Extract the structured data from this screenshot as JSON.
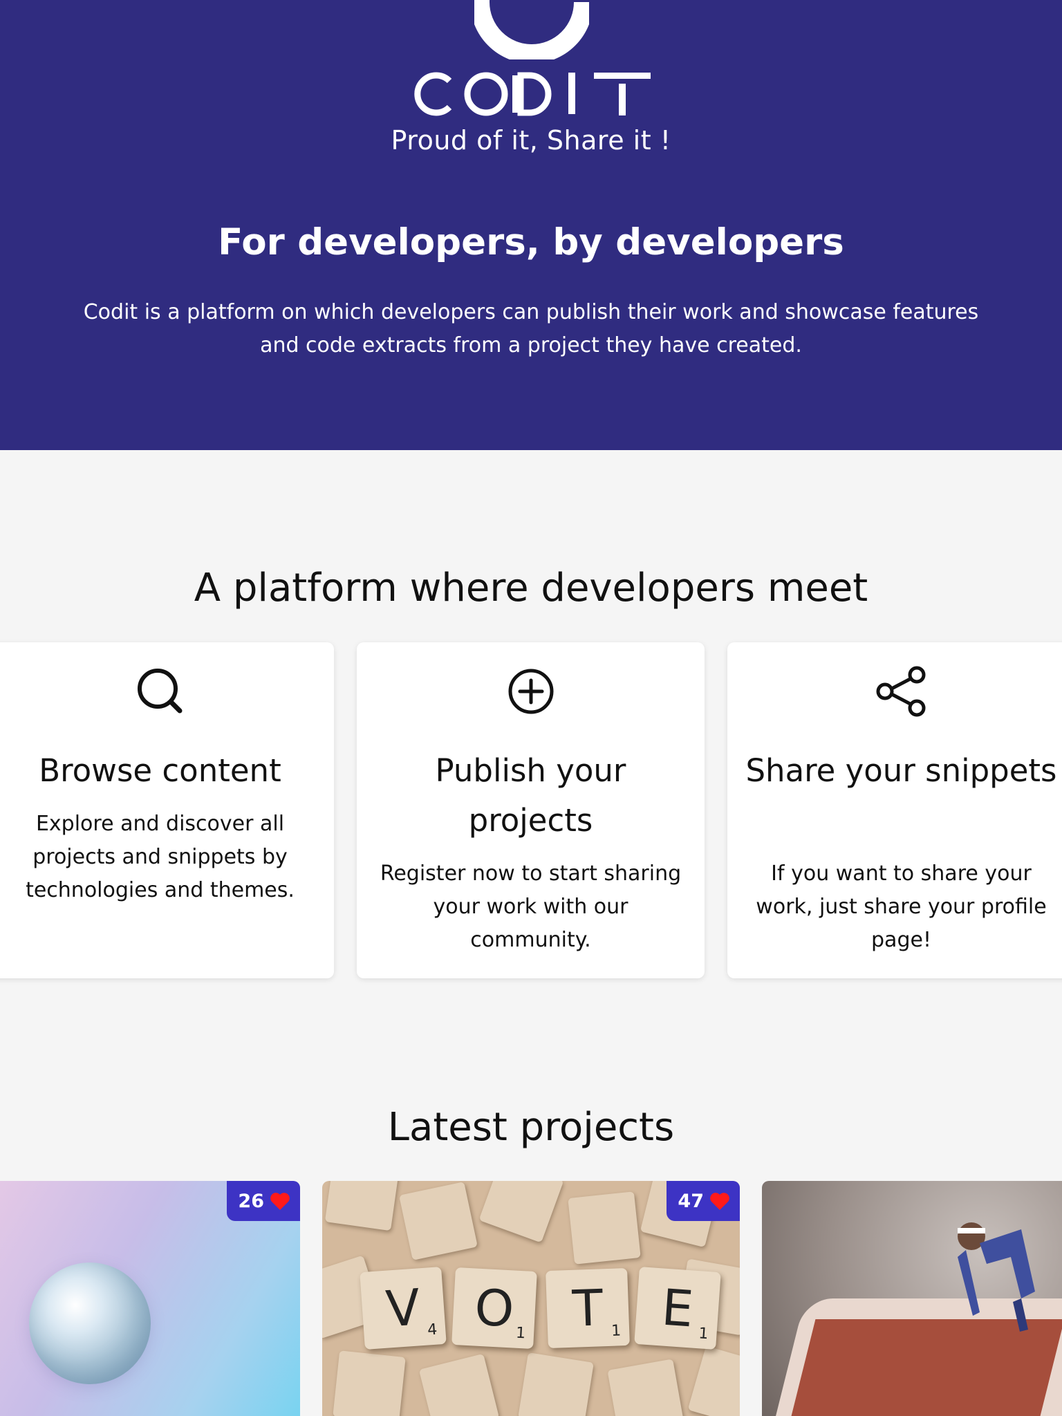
{
  "hero": {
    "logo_text": "CODIT",
    "tagline": "Proud of it, Share it !",
    "title": "For developers, by developers",
    "description": "Codit is a platform on which developers can publish their work and showcase features and code extracts from a project they have created.",
    "background_color": "#302c80"
  },
  "features": {
    "title": "A platform where developers meet",
    "cards": [
      {
        "icon": "search-icon",
        "title": "Browse content",
        "description": "Explore and discover all projects and snippets by technologies and themes."
      },
      {
        "icon": "plus-circle-icon",
        "title": "Publish your projects",
        "description": "Register now to start sharing your work with our community."
      },
      {
        "icon": "share-icon",
        "title": "Share your snippets",
        "description": "If you want to share your work, just share your profile page!"
      }
    ]
  },
  "projects": {
    "title": "Latest projects",
    "items": [
      {
        "likes": "26",
        "image": "iridescent-sphere"
      },
      {
        "likes": "47",
        "image": "scrabble-vote",
        "letters": [
          {
            "char": "V",
            "score": "4"
          },
          {
            "char": "O",
            "score": "1"
          },
          {
            "char": "T",
            "score": "1"
          },
          {
            "char": "E",
            "score": "1"
          }
        ]
      },
      {
        "likes": null,
        "image": "runner-on-phone"
      }
    ],
    "badge_color": "#3d33c4",
    "heart_color": "#ff1a1a"
  }
}
